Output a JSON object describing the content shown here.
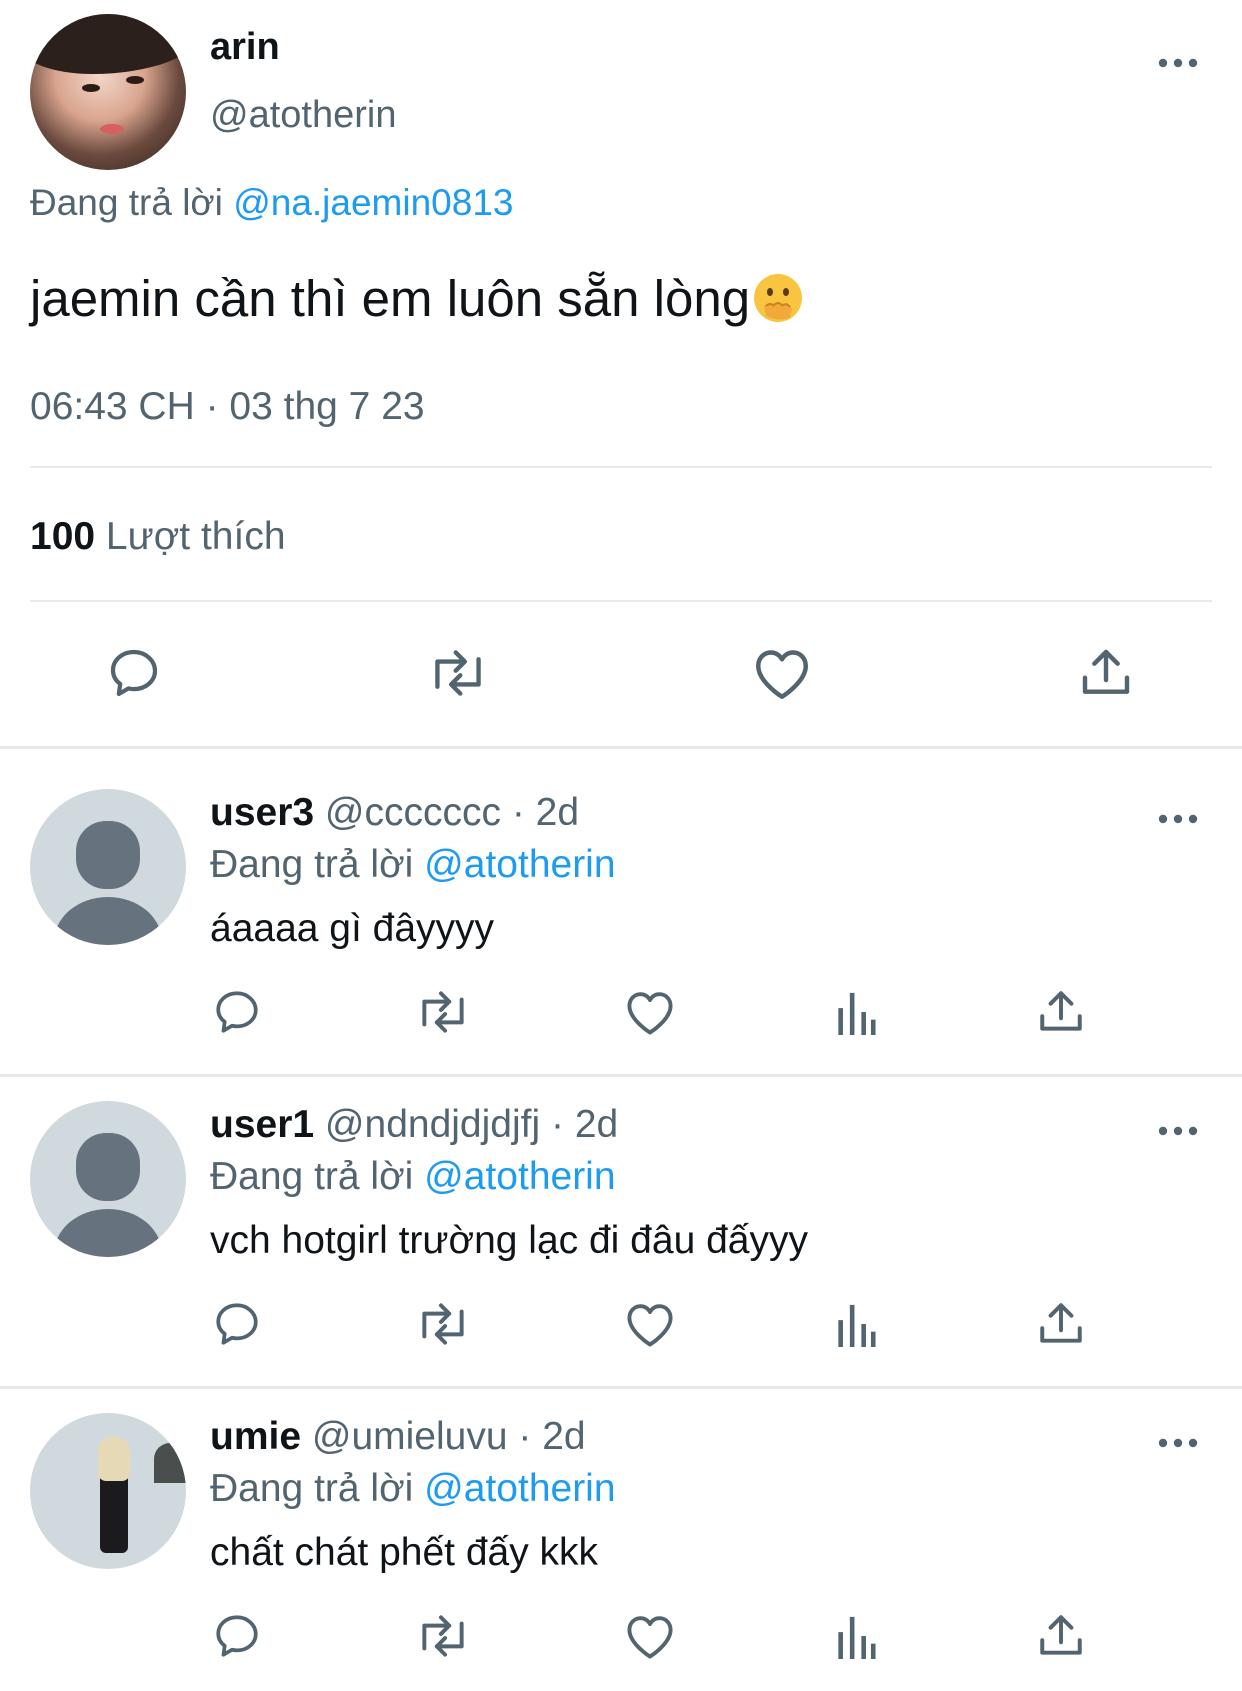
{
  "tweet": {
    "author_name": "arin",
    "author_handle": "@atotherin",
    "replying_prefix": "Đang trả lời",
    "replying_to": "@na.jaemin0813",
    "text": "jaemin cần thì em luôn sẵn lòng",
    "emoji_icon": "face-with-hand-over-mouth-icon",
    "timestamp": "06:43 CH · 03 thg 7 23",
    "likes_count": "100",
    "likes_label": "Lượt thích"
  },
  "replies": [
    {
      "name": "user3",
      "handle": "@ccccccc",
      "time": "· 2d",
      "replying_prefix": "Đang trả lời",
      "replying_to": "@atotherin",
      "text": "áaaaa gì đâyyyy",
      "avatar": "default"
    },
    {
      "name": "user1",
      "handle": "@ndndjdjdjfj",
      "time": "· 2d",
      "replying_prefix": "Đang trả lời",
      "replying_to": "@atotherin",
      "text": "vch hotgirl trường lạc đi đâu đấyyy",
      "avatar": "default"
    },
    {
      "name": "umie",
      "handle": "@umieluvu",
      "time": "· 2d",
      "replying_prefix": "Đang trả lời",
      "replying_to": "@atotherin",
      "text": "chất chát phết đấy kkk",
      "avatar": "photo"
    }
  ],
  "colors": {
    "text": "#0f1419",
    "secondary": "#536471",
    "link": "#1d9bf0",
    "divider": "#e7e9ea"
  }
}
